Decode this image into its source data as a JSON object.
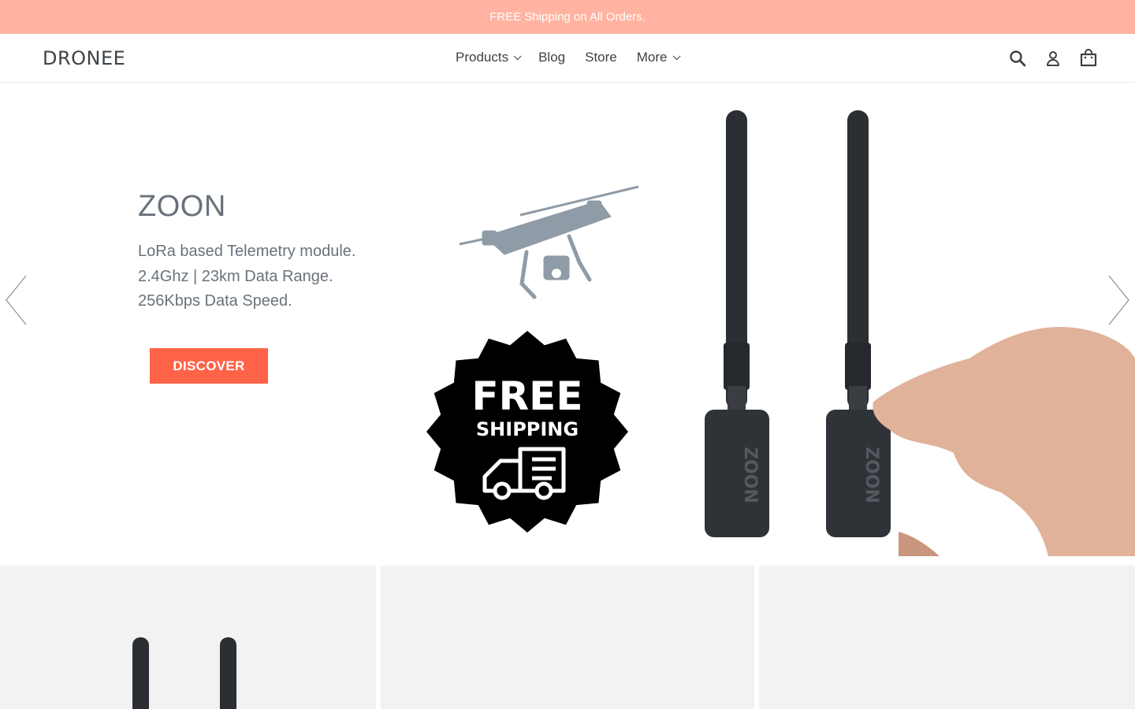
{
  "announcement": {
    "text": "FREE Shipping on All Orders."
  },
  "header": {
    "logo": "DRONEE",
    "nav": [
      {
        "label": "Products",
        "has_dropdown": true
      },
      {
        "label": "Blog",
        "has_dropdown": false
      },
      {
        "label": "Store",
        "has_dropdown": false
      },
      {
        "label": "More",
        "has_dropdown": true
      }
    ],
    "icons": [
      "search-icon",
      "account-icon",
      "cart-icon"
    ]
  },
  "hero": {
    "title": "ZOON",
    "subtitle_lines": [
      "LoRa based Telemetry module.",
      "2.4Ghz | 23km Data Range.",
      "256Kbps Data Speed."
    ],
    "button_label": "DISCOVER",
    "badge_line1": "FREE",
    "badge_line2": "SHIPPING",
    "device_label": "ZOON"
  },
  "colors": {
    "announcement_bg": "#ffb3a0",
    "accent": "#ff6347",
    "text": "#3d4246",
    "muted_text": "#69727b",
    "card_bg": "#f2f2f2"
  }
}
